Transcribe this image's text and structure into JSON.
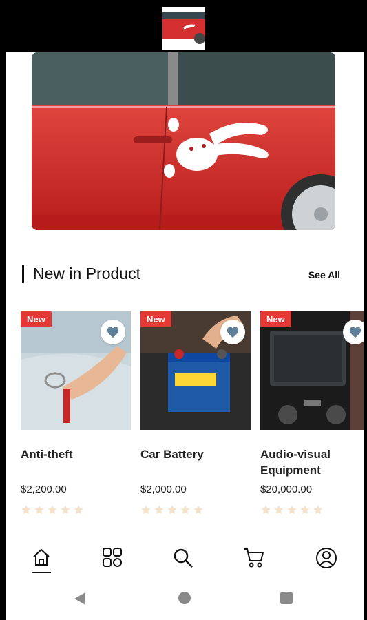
{
  "section": {
    "title": "New in Product",
    "see_all": "See All"
  },
  "products": [
    {
      "badge": "New",
      "name": "Anti-theft",
      "price": "$2,200.00",
      "rating": 0,
      "image": "car door unlock photo",
      "favorited": false
    },
    {
      "badge": "New",
      "name": "Car Battery",
      "price": "$2,000.00",
      "rating": 0,
      "image": "car battery photo",
      "favorited": false
    },
    {
      "badge": "New",
      "name": "Audio-visual Equipment",
      "price": "$20,000.00",
      "rating": 0,
      "image": "car dashboard photo",
      "favorited": false
    }
  ],
  "nav": {
    "items": [
      {
        "icon": "home-icon",
        "active": true
      },
      {
        "icon": "grid-icon",
        "active": false
      },
      {
        "icon": "search-icon",
        "active": false
      },
      {
        "icon": "cart-icon",
        "active": false
      },
      {
        "icon": "profile-icon",
        "active": false
      }
    ]
  },
  "system_nav": [
    "back-icon",
    "home-circle-icon",
    "recents-icon"
  ],
  "colors": {
    "badge": "#e53935",
    "heart": "#5f7f98",
    "star_empty": "#f3e3cc",
    "car_red": "#d32f2f"
  }
}
